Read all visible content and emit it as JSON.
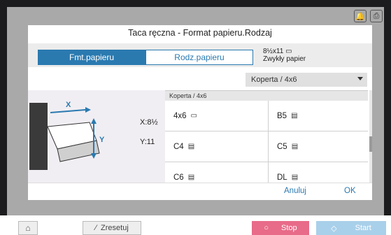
{
  "dialog": {
    "title": "Taca ręczna - Format papieru.Rodzaj",
    "tabs": [
      {
        "label": "Fmt.papieru",
        "active": true
      },
      {
        "label": "Rodz.papieru",
        "active": false
      }
    ],
    "paper_info": {
      "size": "8½x11",
      "type": "Zwykły papier"
    },
    "select": {
      "value": "Koperta  /  4x6"
    },
    "size_readout": {
      "x": "X:8½",
      "y": "Y:11"
    },
    "grid_header": "Koperta   /  4x6",
    "cells": [
      {
        "label": "4x6",
        "icon": "portrait-paper-icon"
      },
      {
        "label": "B5",
        "icon": "landscape-paper-icon"
      },
      {
        "label": "C4",
        "icon": "landscape-paper-icon"
      },
      {
        "label": "C5",
        "icon": "landscape-paper-icon"
      },
      {
        "label": "C6",
        "icon": "landscape-paper-icon"
      },
      {
        "label": "DL",
        "icon": "landscape-paper-icon"
      }
    ],
    "cancel_label": "Anuluj",
    "ok_label": "OK"
  },
  "bottom_bar": {
    "reset_label": "Zresetuj",
    "stop_label": "Stop",
    "start_label": "Start"
  },
  "colors": {
    "accent": "#2a7ab0",
    "stop": "#e86b89",
    "start": "#a9d0ea"
  }
}
